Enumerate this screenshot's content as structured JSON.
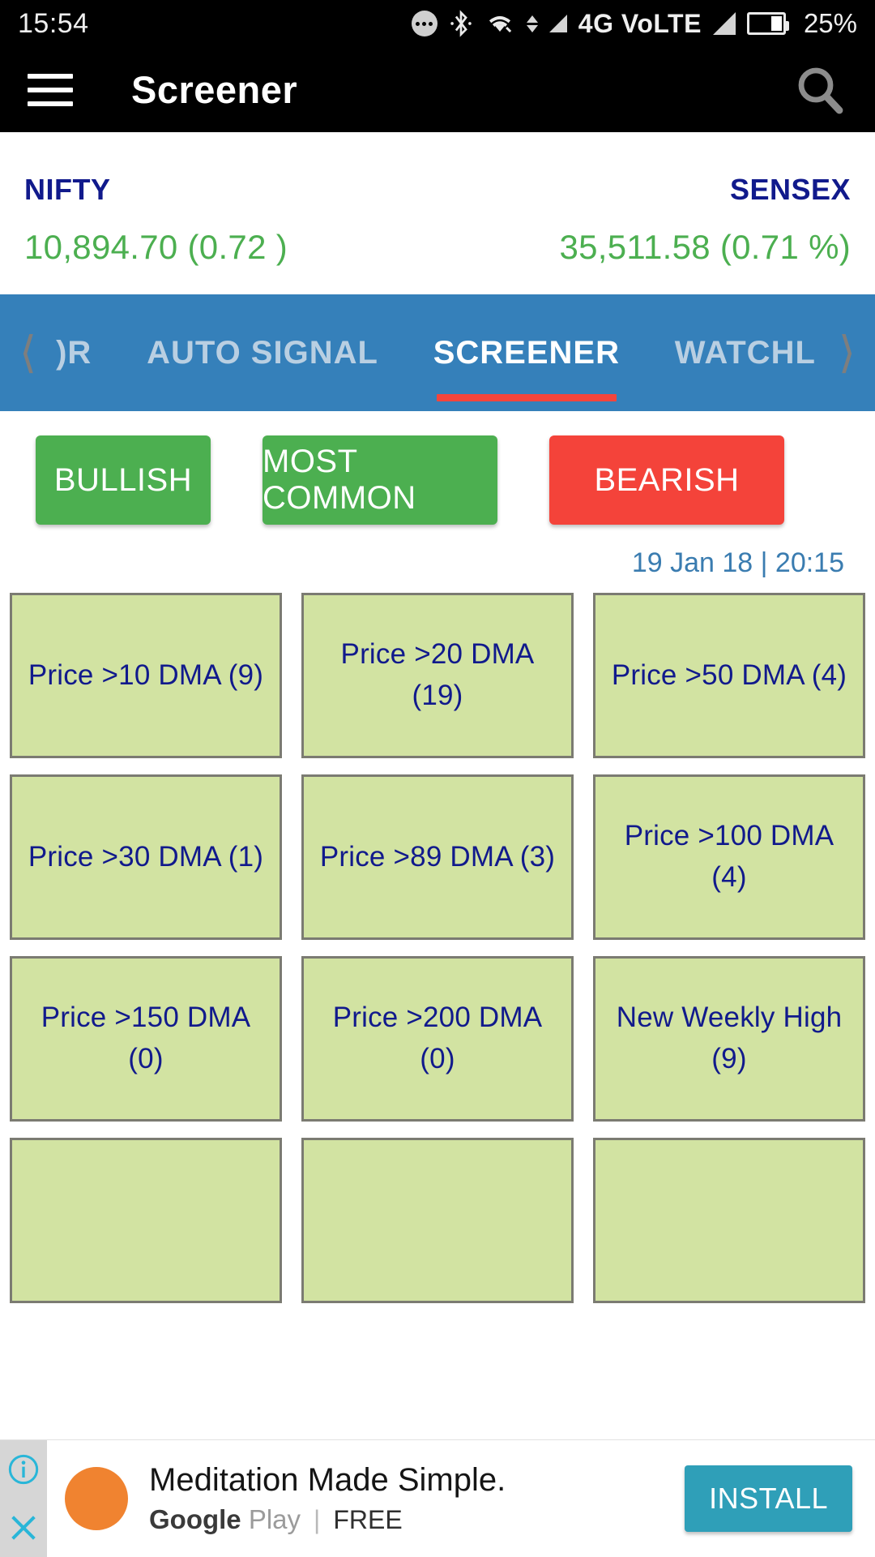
{
  "status_bar": {
    "time": "15:54",
    "network": "4G VoLTE",
    "battery_percent": "25%",
    "icons": [
      "more-dots-icon",
      "bluetooth-icon",
      "wifi-icon",
      "data-transfer-icon",
      "signal-icon",
      "signal-icon-2",
      "battery-icon"
    ]
  },
  "app_bar": {
    "title": "Screener",
    "menu_icon": "hamburger-menu-icon",
    "search_icon": "search-icon"
  },
  "indices": [
    {
      "name": "NIFTY",
      "value": "10,894.70 (0.72 )"
    },
    {
      "name": "SENSEX",
      "value": "35,511.58 (0.71 %)"
    }
  ],
  "tabs": {
    "prev_icon": "chevron-left-icon",
    "next_icon": "chevron-right-icon",
    "items": [
      {
        "label": ")R",
        "active": false
      },
      {
        "label": "AUTO SIGNAL",
        "active": false
      },
      {
        "label": "SCREENER",
        "active": true
      },
      {
        "label": "WATCHL",
        "active": false
      }
    ]
  },
  "sentiment_buttons": [
    {
      "label": "BULLISH"
    },
    {
      "label": "MOST COMMON"
    },
    {
      "label": "BEARISH"
    }
  ],
  "timestamp": "19 Jan 18 | 20:15",
  "screener_tiles": [
    {
      "label": "Price >10 DMA (9)"
    },
    {
      "label": "Price >20 DMA (19)"
    },
    {
      "label": "Price >50 DMA (4)"
    },
    {
      "label": "Price >30 DMA (1)"
    },
    {
      "label": "Price >89 DMA (3)"
    },
    {
      "label": "Price >100 DMA (4)"
    },
    {
      "label": "Price >150 DMA (0)"
    },
    {
      "label": "Price >200 DMA (0)"
    },
    {
      "label": "New Weekly High (9)"
    },
    {
      "label": ""
    },
    {
      "label": ""
    },
    {
      "label": ""
    }
  ],
  "ad": {
    "info_icon": "info-icon",
    "close_icon": "close-icon",
    "app_icon": "app-circle-icon",
    "title": "Meditation Made Simple.",
    "store_google": "Google",
    "store_play": "Play",
    "divider": "|",
    "price": "FREE",
    "install_label": "INSTALL"
  },
  "colors": {
    "tab_blue": "#3580ba",
    "active_underline_red": "#f4453c",
    "bullish_green": "#4caf50",
    "bearish_red": "#f4433a",
    "tile_green": "#d2e3a2",
    "tile_text_navy": "#111a8c",
    "index_green": "#4caf50",
    "timestamp_blue": "#3a7cb0",
    "install_teal": "#2f9fb8",
    "ad_orange": "#f08330"
  }
}
